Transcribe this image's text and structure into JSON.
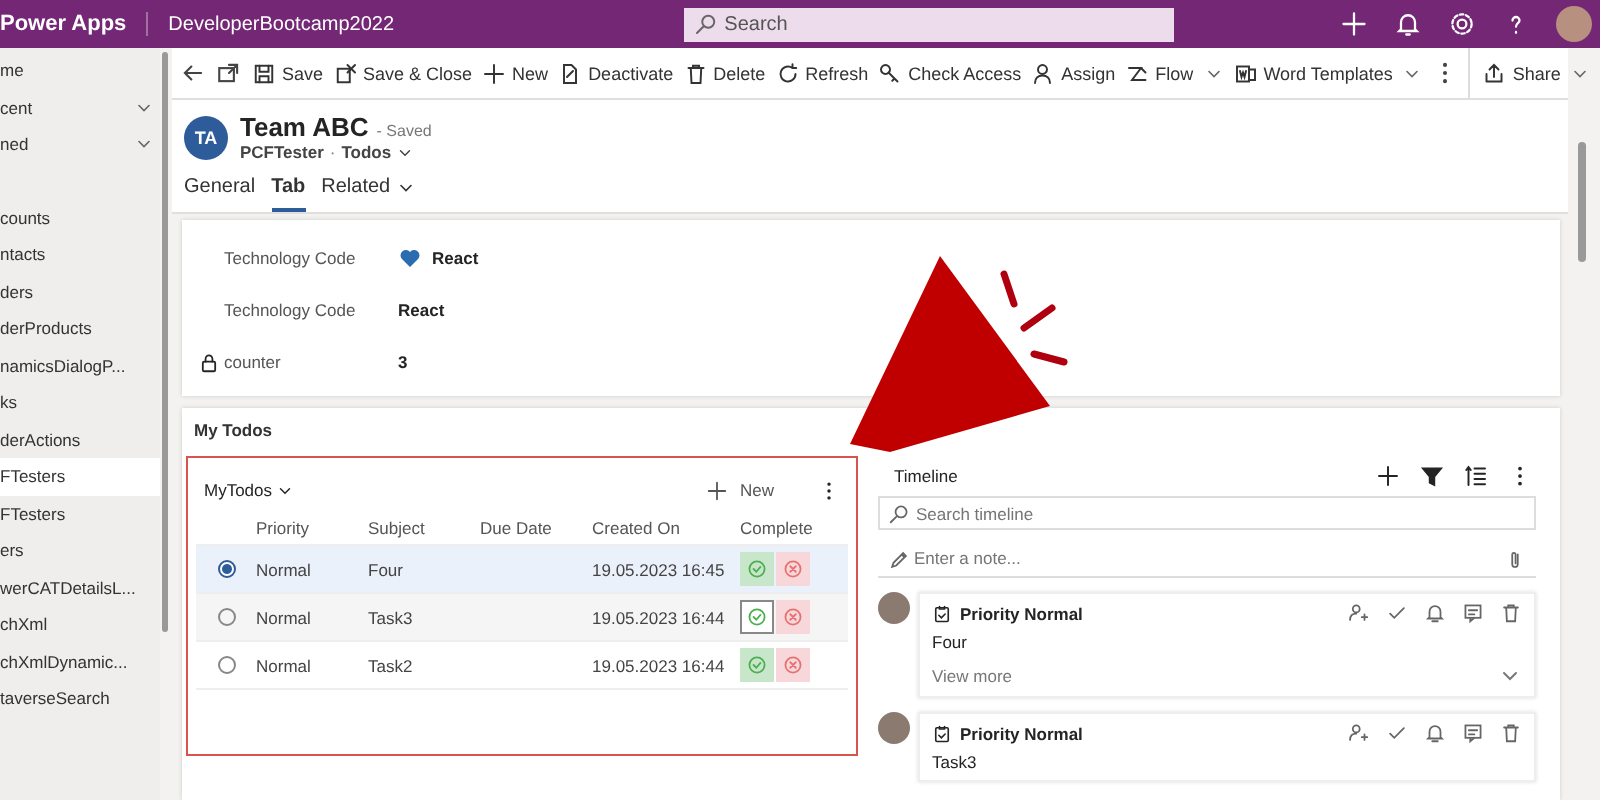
{
  "app_bar": {
    "app_name": "Power Apps",
    "environment": "DeveloperBootcamp2022",
    "search": {
      "placeholder": "Search"
    }
  },
  "sidebar": {
    "items": [
      {
        "label": "me",
        "expandable": false,
        "selected": false
      },
      {
        "label": "cent",
        "expandable": true,
        "selected": false
      },
      {
        "label": "ned",
        "expandable": true,
        "selected": false
      },
      {
        "label": "counts",
        "expandable": false,
        "selected": false
      },
      {
        "label": "ntacts",
        "expandable": false,
        "selected": false
      },
      {
        "label": "ders",
        "expandable": false,
        "selected": false
      },
      {
        "label": "derProducts",
        "expandable": false,
        "selected": false
      },
      {
        "label": "namicsDialogP...",
        "expandable": false,
        "selected": false
      },
      {
        "label": "ks",
        "expandable": false,
        "selected": false
      },
      {
        "label": "derActions",
        "expandable": false,
        "selected": false
      },
      {
        "label": "FTesters",
        "expandable": false,
        "selected": true
      },
      {
        "label": "FTesters",
        "expandable": false,
        "selected": false
      },
      {
        "label": "ers",
        "expandable": false,
        "selected": false
      },
      {
        "label": "werCATDetailsL...",
        "expandable": false,
        "selected": false
      },
      {
        "label": "chXml",
        "expandable": false,
        "selected": false
      },
      {
        "label": "chXmlDynamic...",
        "expandable": false,
        "selected": false
      },
      {
        "label": "taverseSearch",
        "expandable": false,
        "selected": false
      }
    ]
  },
  "command_bar": {
    "items": [
      {
        "label": "Save",
        "dropdown": false
      },
      {
        "label": "Save & Close",
        "dropdown": false
      },
      {
        "label": "New",
        "dropdown": false
      },
      {
        "label": "Deactivate",
        "dropdown": false
      },
      {
        "label": "Delete",
        "dropdown": false
      },
      {
        "label": "Refresh",
        "dropdown": false
      },
      {
        "label": "Check Access",
        "dropdown": false
      },
      {
        "label": "Assign",
        "dropdown": false
      },
      {
        "label": "Flow",
        "dropdown": true
      },
      {
        "label": "Word Templates",
        "dropdown": true
      }
    ],
    "share": "Share"
  },
  "record": {
    "initials": "TA",
    "title": "Team ABC",
    "status": "- Saved",
    "entity": "PCFTester",
    "separator": "·",
    "form": "Todos"
  },
  "tabs": [
    {
      "label": "General",
      "selected": false,
      "dropdown": false
    },
    {
      "label": "Tab",
      "selected": true,
      "dropdown": false
    },
    {
      "label": "Related",
      "selected": false,
      "dropdown": true
    }
  ],
  "fields": [
    {
      "label": "Technology Code",
      "value": "React",
      "kind": "heart",
      "locked": false
    },
    {
      "label": "Technology Code",
      "value": "React",
      "kind": "text",
      "locked": false
    },
    {
      "label": "counter",
      "value": "3",
      "kind": "text",
      "locked": true
    }
  ],
  "section": {
    "title": "My Todos"
  },
  "grid": {
    "view_name": "MyTodos",
    "new_label": "New",
    "columns": [
      "Priority",
      "Subject",
      "Due Date",
      "Created On",
      "Complete"
    ],
    "rows": [
      {
        "selected": true,
        "hovered": false,
        "priority": "Normal",
        "subject": "Four",
        "created_on": "19.05.2023 16:45"
      },
      {
        "selected": false,
        "hovered": true,
        "priority": "Normal",
        "subject": "Task3",
        "created_on": "19.05.2023 16:44"
      },
      {
        "selected": false,
        "hovered": false,
        "priority": "Normal",
        "subject": "Task2",
        "created_on": "19.05.2023 16:44"
      }
    ]
  },
  "timeline": {
    "title": "Timeline",
    "search": {
      "placeholder": "Search timeline"
    },
    "note": {
      "placeholder": "Enter a note..."
    },
    "entries": [
      {
        "title": "Priority Normal",
        "body": "Four",
        "view_more": "View more"
      },
      {
        "title": "Priority Normal",
        "body": "Task3"
      }
    ]
  }
}
